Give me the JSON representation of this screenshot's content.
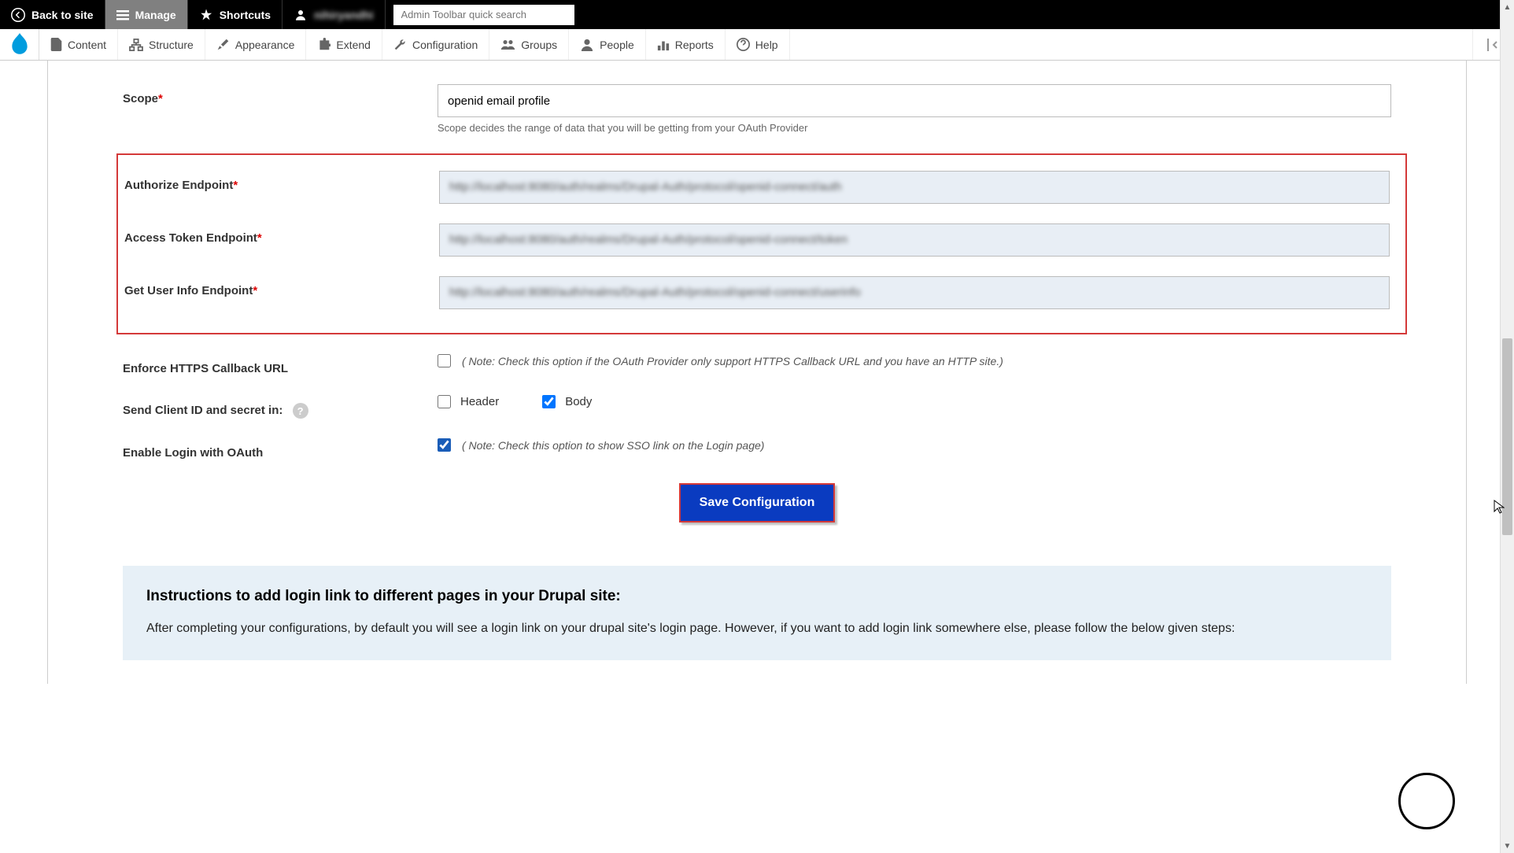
{
  "toolbar": {
    "back_to_site": "Back to site",
    "manage": "Manage",
    "shortcuts": "Shortcuts",
    "username": "nihiryandhi",
    "search_placeholder": "Admin Toolbar quick search"
  },
  "nav": {
    "content": "Content",
    "structure": "Structure",
    "appearance": "Appearance",
    "extend": "Extend",
    "configuration": "Configuration",
    "groups": "Groups",
    "people": "People",
    "reports": "Reports",
    "help": "Help"
  },
  "form": {
    "scope": {
      "label": "Scope",
      "value": "openid email profile",
      "help": "Scope decides the range of data that you will be getting from your OAuth Provider"
    },
    "authorize": {
      "label": "Authorize Endpoint",
      "value": "http://localhost:8080/auth/realms/Drupal-Auth/protocol/openid-connect/auth"
    },
    "token": {
      "label": "Access Token Endpoint",
      "value": "http://localhost:8080/auth/realms/Drupal-Auth/protocol/openid-connect/token"
    },
    "userinfo": {
      "label": "Get User Info Endpoint",
      "value": "http://localhost:8080/auth/realms/Drupal-Auth/protocol/openid-connect/userinfo"
    },
    "enforce_https": {
      "label": "Enforce HTTPS Callback URL",
      "note": "( Note: Check this option if the OAuth Provider only support HTTPS Callback URL and you have an HTTP site.)",
      "checked": false
    },
    "send_in": {
      "label": "Send Client ID and secret in:",
      "header_label": "Header",
      "body_label": "Body",
      "header_checked": false,
      "body_checked": true
    },
    "enable_login": {
      "label": "Enable Login with OAuth",
      "note": "( Note: Check this option to show SSO link on the Login page)",
      "checked": true
    },
    "save_button": "Save Configuration"
  },
  "instructions": {
    "heading": "Instructions to add login link to different pages in your Drupal site:",
    "text": "After completing your configurations, by default you will see a login link on your drupal site's login page. However, if you want to add login link somewhere else, please follow the below given steps:"
  }
}
